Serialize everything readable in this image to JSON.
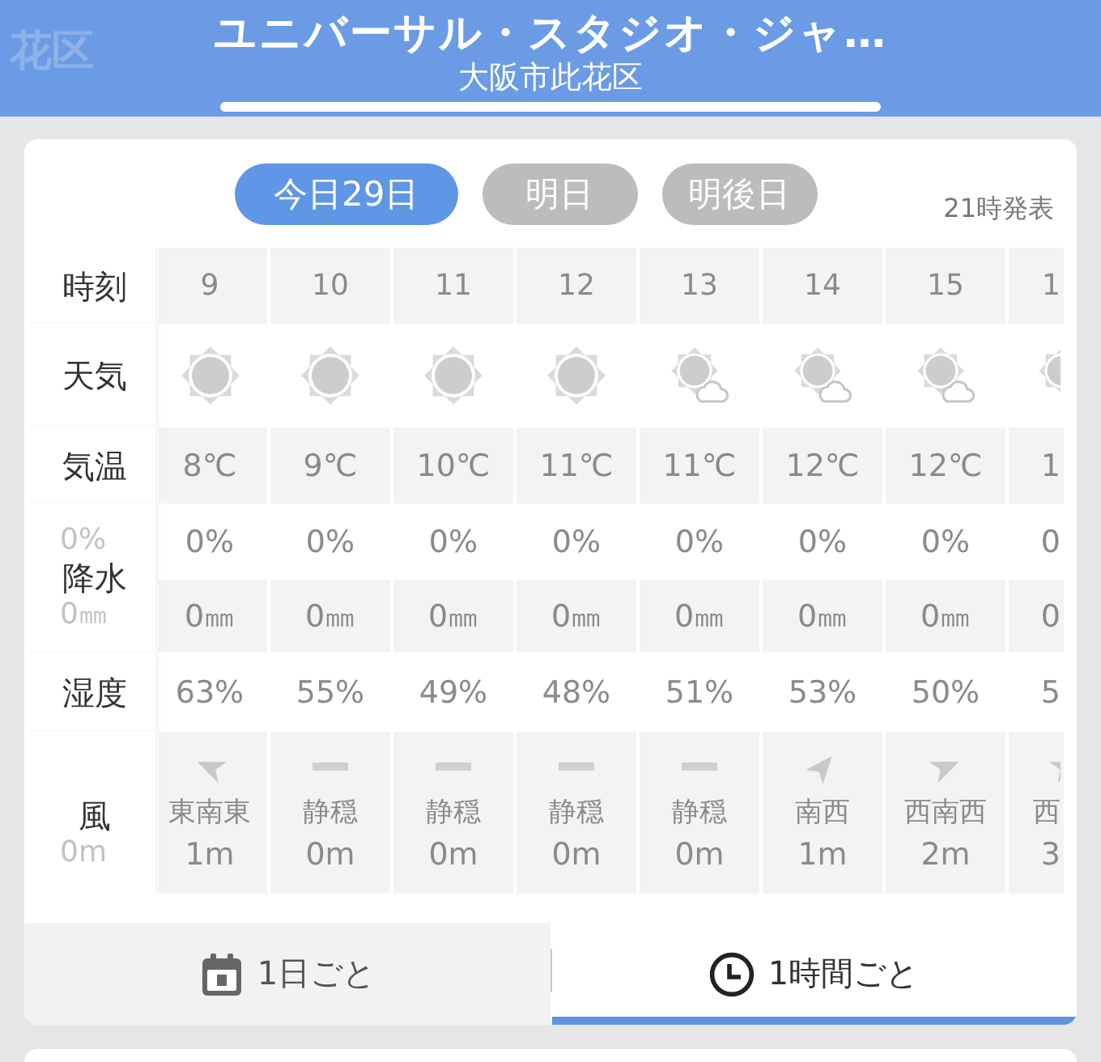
{
  "header": {
    "previous_title": "花区",
    "title": "ユニバーサル・スタジオ・ジャ…",
    "subtitle": "大阪市此花区"
  },
  "day_tabs": [
    {
      "label": "今日29日",
      "selected": true
    },
    {
      "label": "明日",
      "selected": false
    },
    {
      "label": "明後日",
      "selected": false
    }
  ],
  "issued": "21時発表",
  "table": {
    "row_labels": [
      {
        "kind": "time",
        "label": "時刻"
      },
      {
        "kind": "weather",
        "label": "天気"
      },
      {
        "kind": "temperature",
        "label": "気温"
      },
      {
        "kind": "precipitation",
        "label": "降水",
        "faded_behind": [
          "0%",
          "0㎜"
        ]
      },
      {
        "kind": "humidity",
        "label": "湿度"
      },
      {
        "kind": "wind",
        "label": "風",
        "faded_behind": [
          "0m"
        ]
      }
    ],
    "hours": [
      {
        "time": "9",
        "weather": {
          "kind": "sunny"
        },
        "temperature": "8℃",
        "precip_chance": "0%",
        "precip_amount": "0㎜",
        "humidity": "63%",
        "wind": {
          "kind": "arrow_wnw",
          "direction": "東南東",
          "speed": "1m"
        },
        "partial": false
      },
      {
        "time": "10",
        "weather": {
          "kind": "sunny"
        },
        "temperature": "9℃",
        "precip_chance": "0%",
        "precip_amount": "0㎜",
        "humidity": "55%",
        "wind": {
          "kind": "calm",
          "direction": "静穏",
          "speed": "0m"
        },
        "partial": false
      },
      {
        "time": "11",
        "weather": {
          "kind": "sunny"
        },
        "temperature": "10℃",
        "precip_chance": "0%",
        "precip_amount": "0㎜",
        "humidity": "49%",
        "wind": {
          "kind": "calm",
          "direction": "静穏",
          "speed": "0m"
        },
        "partial": false
      },
      {
        "time": "12",
        "weather": {
          "kind": "sunny"
        },
        "temperature": "11℃",
        "precip_chance": "0%",
        "precip_amount": "0㎜",
        "humidity": "48%",
        "wind": {
          "kind": "calm",
          "direction": "静穏",
          "speed": "0m"
        },
        "partial": false
      },
      {
        "time": "13",
        "weather": {
          "kind": "sun_cloud"
        },
        "temperature": "11℃",
        "precip_chance": "0%",
        "precip_amount": "0㎜",
        "humidity": "51%",
        "wind": {
          "kind": "calm",
          "direction": "静穏",
          "speed": "0m"
        },
        "partial": false
      },
      {
        "time": "14",
        "weather": {
          "kind": "sun_cloud"
        },
        "temperature": "12℃",
        "precip_chance": "0%",
        "precip_amount": "0㎜",
        "humidity": "53%",
        "wind": {
          "kind": "arrow_ne",
          "direction": "南西",
          "speed": "1m"
        },
        "partial": false
      },
      {
        "time": "15",
        "weather": {
          "kind": "sun_cloud"
        },
        "temperature": "12℃",
        "precip_chance": "0%",
        "precip_amount": "0㎜",
        "humidity": "50%",
        "wind": {
          "kind": "arrow_ene",
          "direction": "西南西",
          "speed": "2m"
        },
        "partial": false
      },
      {
        "time": "1",
        "weather": {
          "kind": "sun_cloud"
        },
        "temperature": "1",
        "precip_chance": "0",
        "precip_amount": "0",
        "humidity": "5",
        "wind": {
          "kind": "arrow_ene",
          "direction": "西",
          "speed": "3"
        },
        "partial": true
      }
    ]
  },
  "view_tabs": [
    {
      "kind": "daily",
      "label": "1日ごと",
      "selected": false
    },
    {
      "kind": "hourly",
      "label": "1時間ごと",
      "selected": true
    }
  ]
}
